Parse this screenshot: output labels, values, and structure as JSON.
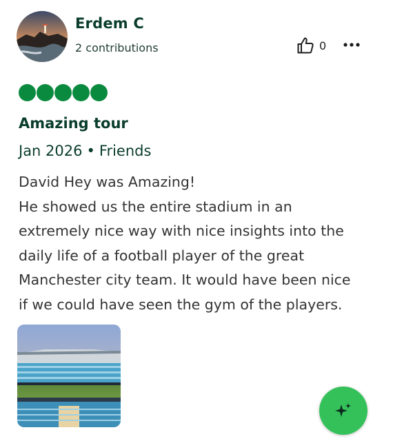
{
  "review": {
    "author": {
      "name": "Erdem C",
      "contributions": "2 contributions"
    },
    "likes": "0",
    "rating": 5,
    "title": "Amazing tour",
    "date": "Jan 2026",
    "trip_type": "Friends",
    "body_lines": [
      "David Hey was Amazing!",
      "He showed us the entire stadium in an",
      "extremely nice way with nice insights into the",
      "daily life of a football player of the great",
      "Manchester city team. It would have been nice",
      "if we could have seen the gym of the players."
    ]
  },
  "colors": {
    "brand_green": "#0a8a3e",
    "heading_green": "#0a3d2c",
    "fab_green": "#35c15a"
  },
  "icons": {
    "like": "thumbs-up-icon",
    "more": "more-horizontal-icon",
    "fab": "sparkle-icon"
  }
}
